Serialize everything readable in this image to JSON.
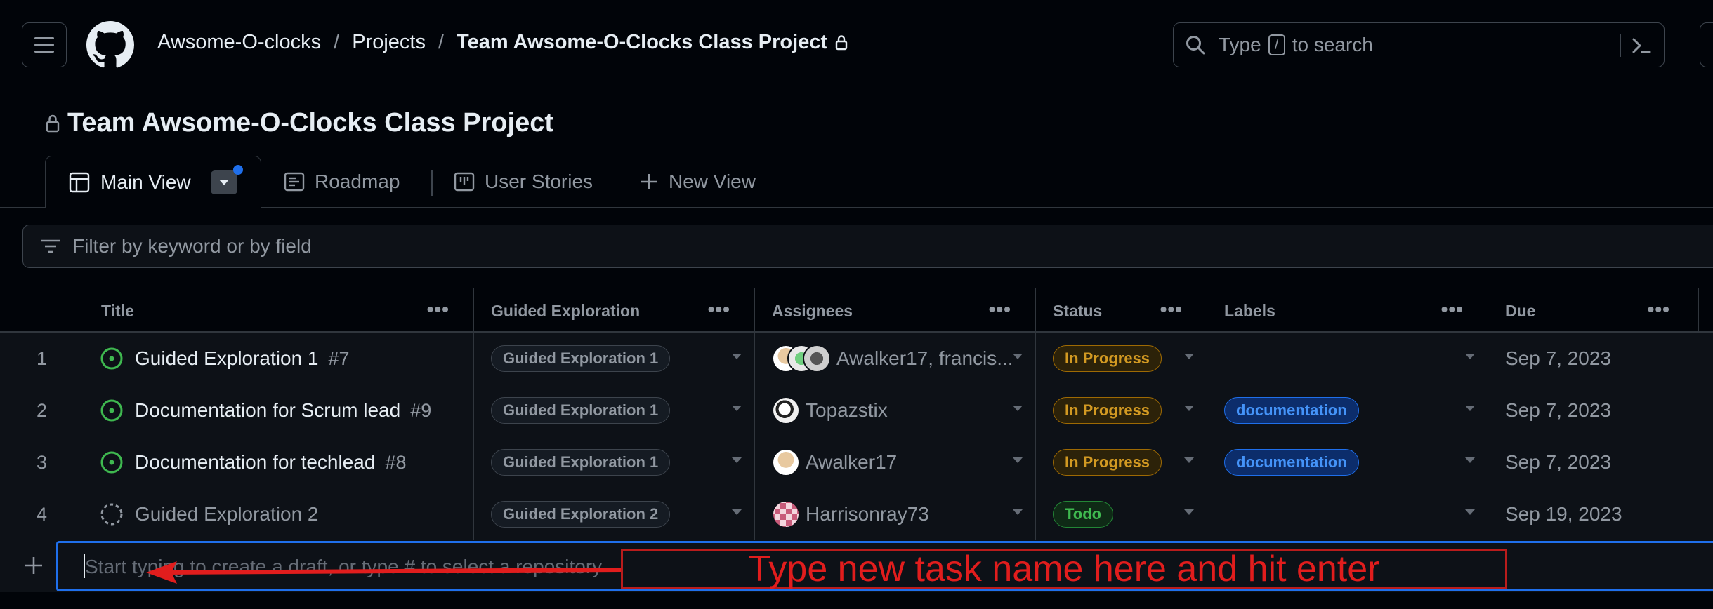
{
  "breadcrumb": {
    "owner": "Awsome-O-clocks",
    "projects": "Projects",
    "project": "Team Awsome-O-Clocks Class Project",
    "sep1": "/",
    "sep2": "/"
  },
  "search": {
    "prefix": "Type",
    "key": "/",
    "suffix": "to search"
  },
  "project": {
    "title": "Team Awsome-O-Clocks Class Project"
  },
  "tabs": [
    {
      "label": "Main View",
      "icon": "table-icon",
      "active": true
    },
    {
      "label": "Roadmap",
      "icon": "roadmap-icon"
    },
    {
      "label": "User Stories",
      "icon": "board-icon"
    },
    {
      "label": "New View",
      "icon": "plus-icon"
    }
  ],
  "filter": {
    "placeholder": "Filter by keyword or by field"
  },
  "table": {
    "columns": [
      "Title",
      "Guided Exploration",
      "Assignees",
      "Status",
      "Labels",
      "Due"
    ],
    "column_menu": "•••",
    "rows": [
      {
        "index": "1",
        "title": "Guided Exploration 1",
        "issue": "#7",
        "state": "open",
        "guided": "Guided Exploration 1",
        "assignees": "Awalker17, francis...",
        "status": "In Progress",
        "label": "",
        "due": "Sep 7, 2023"
      },
      {
        "index": "2",
        "title": "Documentation for Scrum lead",
        "issue": "#9",
        "state": "open",
        "guided": "Guided Exploration 1",
        "assignees": "Topazstix",
        "status": "In Progress",
        "label": "documentation",
        "due": "Sep 7, 2023"
      },
      {
        "index": "3",
        "title": "Documentation for techlead",
        "issue": "#8",
        "state": "open",
        "guided": "Guided Exploration 1",
        "assignees": "Awalker17",
        "status": "In Progress",
        "label": "documentation",
        "due": "Sep 7, 2023"
      },
      {
        "index": "4",
        "title": "Guided Exploration 2",
        "issue": "",
        "state": "draft",
        "guided": "Guided Exploration 2",
        "assignees": "Harrisonray73",
        "status": "Todo",
        "label": "",
        "due": "Sep 19, 2023"
      }
    ]
  },
  "add_item": {
    "placeholder": "Start typing to create a draft, or type # to select a repository"
  },
  "annotation": {
    "text": "Type new task name here and hit enter"
  },
  "colors": {
    "accent": "#1f6feb",
    "open_issue": "#3fb950",
    "in_progress": "#d29922",
    "annotation": "#e11d1d"
  }
}
